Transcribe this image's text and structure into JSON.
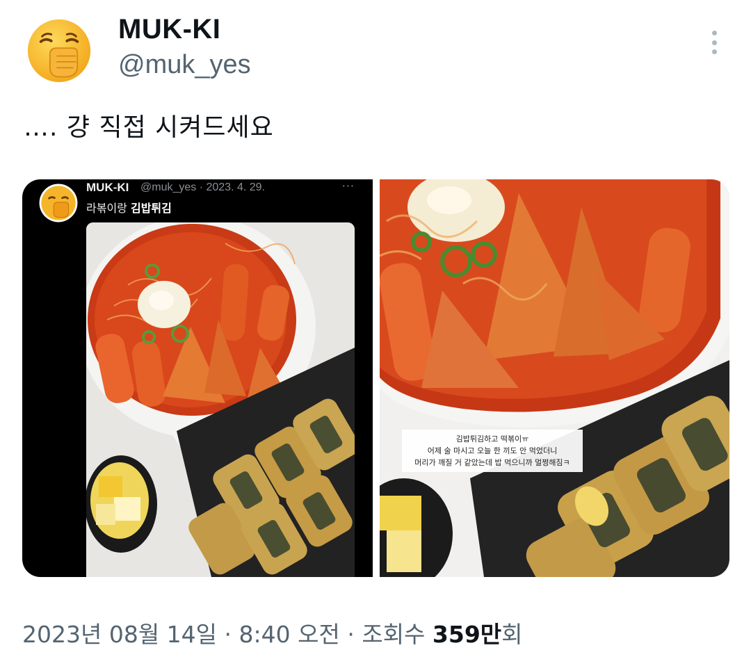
{
  "author": {
    "display_name": "MUK-KI",
    "handle": "@muk_yes",
    "avatar_icon": "yawning-face-emoji-icon"
  },
  "tweet": {
    "text": "…. 걍 직접 시켜드세요"
  },
  "media": {
    "left_photo": {
      "name": "MUK-KI",
      "handle_date": "@muk_yes · 2023. 4. 29.",
      "more": "···",
      "text_prefix": "라볶이랑 ",
      "text_bold": "김밥튀김"
    },
    "right_photo": {
      "caption_lines": [
        "김밥튀김하고 떡볶이ㅠ",
        "어제 술 마시고 오늘 한 끼도 안 먹었더니",
        "머리가 깨질 거 같았는데 밥 먹으니까 멀쩡해짐ㅋ"
      ]
    }
  },
  "footer": {
    "date": "2023년 08월 14일",
    "separator": " · ",
    "time": "8:40 오전",
    "views_label": "조회수 ",
    "views_value": "359만",
    "views_suffix": "회"
  },
  "colors": {
    "text_primary": "#0f1419",
    "text_secondary": "#536471",
    "sauce": "#d2441c",
    "emoji_yellow": "#f7bb2a"
  }
}
